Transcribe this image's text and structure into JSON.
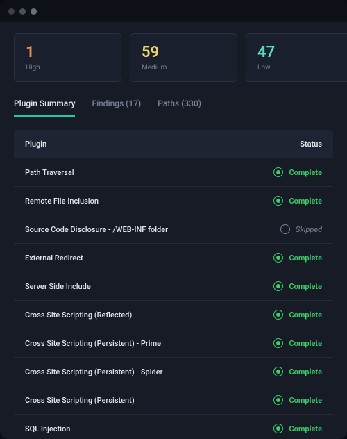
{
  "summary": [
    {
      "count": "1",
      "label": "High",
      "colorClass": "count-high"
    },
    {
      "count": "59",
      "label": "Medium",
      "colorClass": "count-medium"
    },
    {
      "count": "47",
      "label": "Low",
      "colorClass": "count-low"
    }
  ],
  "tabs": [
    {
      "label": "Plugin Summary",
      "active": true
    },
    {
      "label": "Findings (17)",
      "active": false
    },
    {
      "label": "Paths (330)",
      "active": false
    }
  ],
  "table": {
    "headers": {
      "plugin": "Plugin",
      "status": "Status"
    },
    "rows": [
      {
        "name": "Path Traversal",
        "status": "Complete"
      },
      {
        "name": "Remote File Inclusion",
        "status": "Complete"
      },
      {
        "name": "Source Code Disclosure - /WEB-INF folder",
        "status": "Skipped"
      },
      {
        "name": "External Redirect",
        "status": "Complete"
      },
      {
        "name": "Server Side Include",
        "status": "Complete"
      },
      {
        "name": "Cross Site Scripting (Reflected)",
        "status": "Complete"
      },
      {
        "name": "Cross Site Scripting (Persistent) - Prime",
        "status": "Complete"
      },
      {
        "name": "Cross Site Scripting (Persistent) - Spider",
        "status": "Complete"
      },
      {
        "name": "Cross Site Scripting (Persistent)",
        "status": "Complete"
      },
      {
        "name": "SQL Injection",
        "status": "Complete"
      }
    ]
  },
  "statusLabels": {
    "complete": "Complete",
    "skipped": "Skipped"
  }
}
